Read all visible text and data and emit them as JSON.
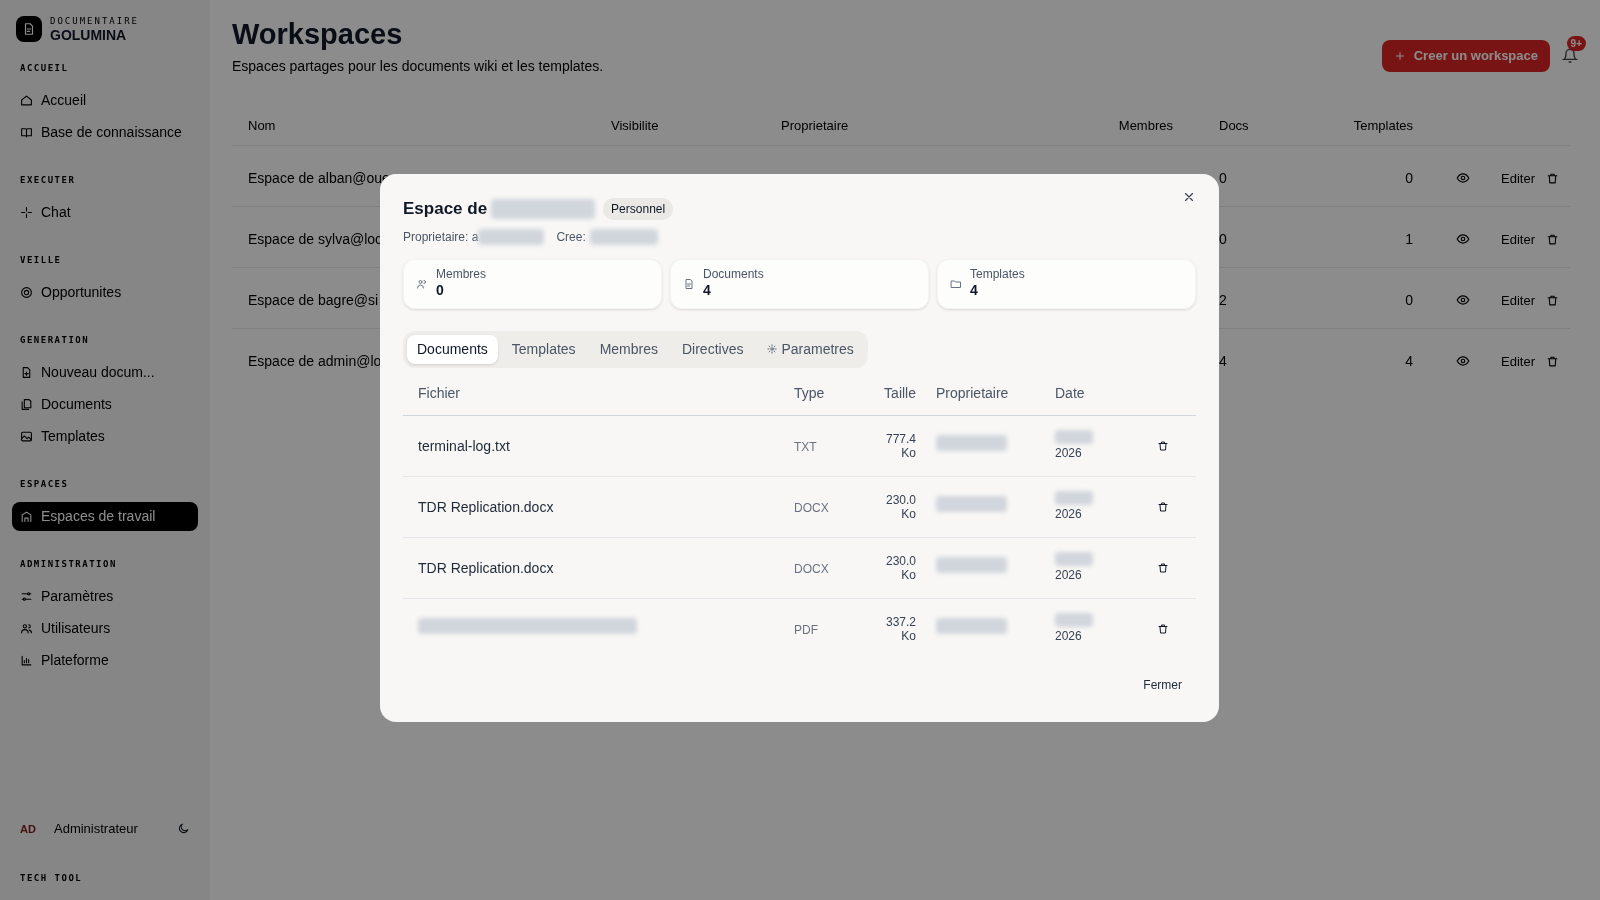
{
  "sidebar": {
    "brand_caption": "DOCUMENTAIRE",
    "brand": "GOLUMINA",
    "sections": [
      {
        "heading": "ACCUEIL",
        "items": [
          {
            "label": "Accueil",
            "selected": false
          },
          {
            "label": "Base de connaissance",
            "selected": false
          }
        ]
      },
      {
        "heading": "EXECUTER",
        "items": [
          {
            "label": "Chat",
            "selected": false
          }
        ]
      },
      {
        "heading": "VEILLE",
        "items": [
          {
            "label": "Opportunites",
            "selected": false
          }
        ]
      },
      {
        "heading": "GENERATION",
        "items": [
          {
            "label": "Nouveau docum...",
            "selected": false
          },
          {
            "label": "Documents",
            "selected": false
          },
          {
            "label": "Templates",
            "selected": false
          }
        ]
      },
      {
        "heading": "ESPACES",
        "items": [
          {
            "label": "Espaces de travail",
            "selected": true
          }
        ]
      },
      {
        "heading": "ADMINISTRATION",
        "items": [
          {
            "label": "Paramètres",
            "selected": false
          },
          {
            "label": "Utilisateurs",
            "selected": false
          },
          {
            "label": "Plateforme",
            "selected": false
          }
        ]
      }
    ],
    "user": {
      "initials": "AD",
      "name": "Administrateur"
    },
    "footer": "TECH TOOL"
  },
  "header": {
    "title": "Workspaces",
    "subtitle": "Espaces partages pour les documents wiki et les templates.",
    "create_button": "Creer un workspace",
    "notification_count": "9+"
  },
  "table": {
    "columns": [
      "Nom",
      "Visibilite",
      "Proprietaire",
      "Membres",
      "Docs",
      "Templates"
    ],
    "rows": [
      {
        "name": "Espace de alban@oue",
        "docs": "0",
        "templates": "0",
        "edit": "Editer"
      },
      {
        "name": "Espace de sylva@loc",
        "docs": "0",
        "templates": "1",
        "edit": "Editer"
      },
      {
        "name": "Espace de bagre@si",
        "docs": "2",
        "templates": "0",
        "edit": "Editer"
      },
      {
        "name": "Espace de admin@lo",
        "docs": "4",
        "templates": "4",
        "edit": "Editer"
      }
    ]
  },
  "modal": {
    "title": "Espace de",
    "badge": "Personnel",
    "owner_label": "Proprietaire: a",
    "created_label": "Cree:",
    "stats": [
      {
        "label": "Membres",
        "value": "0"
      },
      {
        "label": "Documents",
        "value": "4"
      },
      {
        "label": "Templates",
        "value": "4"
      }
    ],
    "tabs": [
      {
        "label": "Documents",
        "selected": true
      },
      {
        "label": "Templates",
        "selected": false
      },
      {
        "label": "Membres",
        "selected": false
      },
      {
        "label": "Directives",
        "selected": false
      },
      {
        "label": "Parametres",
        "selected": false
      }
    ],
    "columns": [
      "Fichier",
      "Type",
      "Taille",
      "Proprietaire",
      "Date"
    ],
    "rows": [
      {
        "file": "terminal-log.txt",
        "type": "TXT",
        "size": "777.4 Ko",
        "date": "2026"
      },
      {
        "file": "TDR Replication.docx",
        "type": "DOCX",
        "size": "230.0 Ko",
        "date": "2026"
      },
      {
        "file": "TDR Replication.docx",
        "type": "DOCX",
        "size": "230.0 Ko",
        "date": "2026"
      },
      {
        "type": "PDF",
        "size": "337.2 Ko",
        "date": "2026"
      }
    ],
    "close_button": "Fermer"
  }
}
